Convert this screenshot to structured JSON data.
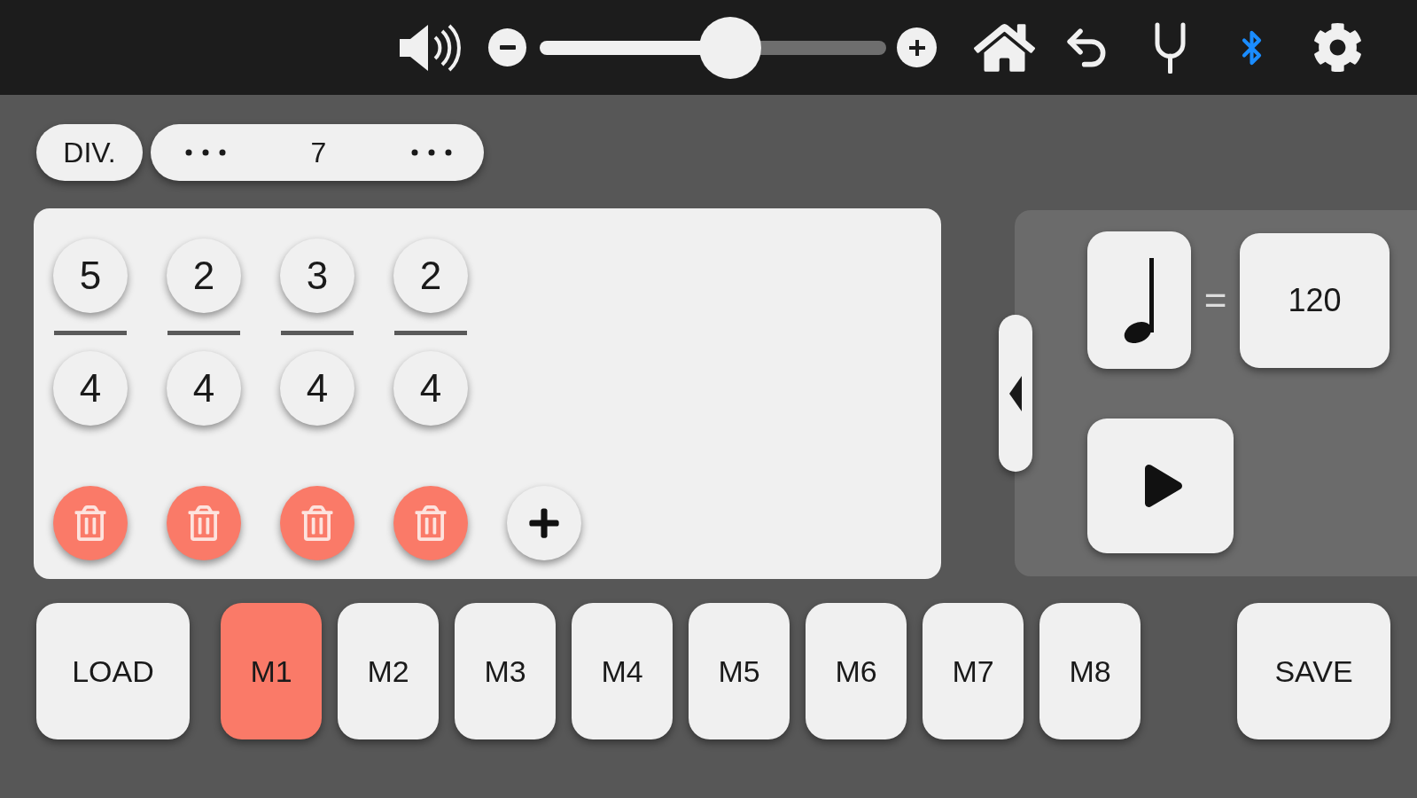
{
  "toolbar": {
    "volume": {
      "level": 0.55
    },
    "bluetooth": {
      "on": true
    }
  },
  "division": {
    "label": "DIV.",
    "value": "7"
  },
  "measures": [
    {
      "numerator": "5",
      "denominator": "4"
    },
    {
      "numerator": "2",
      "denominator": "4"
    },
    {
      "numerator": "3",
      "denominator": "4"
    },
    {
      "numerator": "2",
      "denominator": "4"
    }
  ],
  "tempo": {
    "equals": "=",
    "value": "120"
  },
  "memory": {
    "load": "LOAD",
    "slots": [
      {
        "label": "M1",
        "selected": true
      },
      {
        "label": "M2",
        "selected": false
      },
      {
        "label": "M3",
        "selected": false
      },
      {
        "label": "M4",
        "selected": false
      },
      {
        "label": "M5",
        "selected": false
      },
      {
        "label": "M6",
        "selected": false
      },
      {
        "label": "M7",
        "selected": false
      },
      {
        "label": "M8",
        "selected": false
      }
    ],
    "save": "SAVE"
  }
}
